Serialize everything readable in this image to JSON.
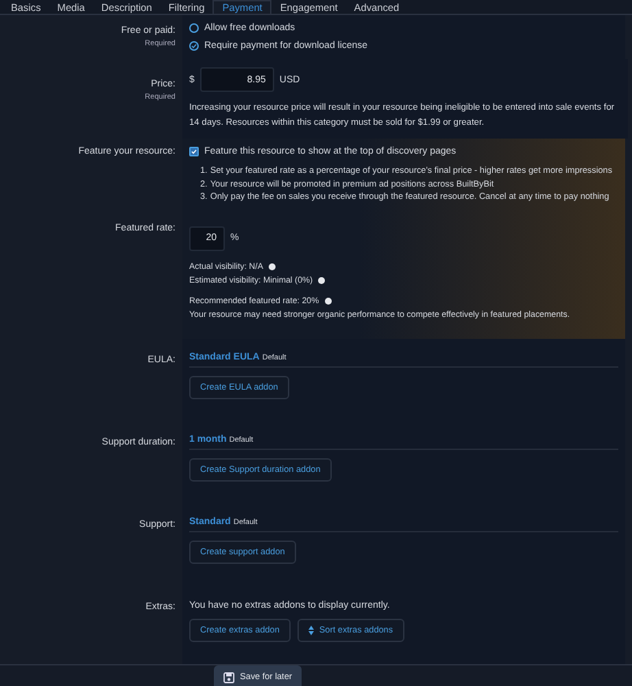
{
  "tabs": [
    {
      "label": "Basics",
      "selected": false
    },
    {
      "label": "Media",
      "selected": false
    },
    {
      "label": "Description",
      "selected": false
    },
    {
      "label": "Filtering",
      "selected": false
    },
    {
      "label": "Payment",
      "selected": true
    },
    {
      "label": "Engagement",
      "selected": false
    },
    {
      "label": "Advanced",
      "selected": false
    }
  ],
  "free_or_paid": {
    "label": "Free or paid:",
    "hint": "Required",
    "options": [
      {
        "label": "Allow free downloads",
        "selected": false
      },
      {
        "label": "Require payment for download license",
        "selected": true
      }
    ]
  },
  "price": {
    "label": "Price:",
    "hint": "Required",
    "prefix": "$",
    "value": "8.95",
    "suffix": "USD",
    "note": "Increasing your resource price will result in your resource being ineligible to be entered into sale events for 14 days. Resources within this category must be sold for $1.99 or greater."
  },
  "feature": {
    "label": "Feature your resource:",
    "checkbox": {
      "label": "Feature this resource to show at the top of discovery pages",
      "checked": true
    },
    "steps": [
      {
        "number": "1.",
        "text": "Set your featured rate as a percentage of your resource's final price - higher rates get more impressions"
      },
      {
        "number": "2.",
        "text": "Your resource will be promoted in premium ad positions across BuiltByBit"
      },
      {
        "number": "3.",
        "text": "Only pay the fee on sales you receive through the featured resource. Cancel at any time to pay nothing"
      }
    ]
  },
  "featured_rate": {
    "label": "Featured rate:",
    "value": "20",
    "suffix": "%",
    "actual_visibility": "Actual visibility: N/A",
    "estimated_visibility": "Estimated visibility: Minimal (0%)",
    "recommended": "Recommended featured rate: 20%",
    "advice": "Your resource may need stronger organic performance to compete effectively in featured placements."
  },
  "addons": [
    {
      "label": "EULA:",
      "value": "Standard EULA",
      "tag": "Default",
      "button": "Create EULA addon"
    },
    {
      "label": "Support duration:",
      "value": "1 month",
      "tag": "Default",
      "button": "Create Support duration addon"
    },
    {
      "label": "Support:",
      "value": "Standard",
      "tag": "Default",
      "button": "Create support addon"
    }
  ],
  "extras": {
    "label": "Extras:",
    "message": "You have no extras addons to display currently.",
    "buttons": [
      "Create extras addon",
      "Sort extras addons"
    ]
  },
  "save_button": "Save for later"
}
